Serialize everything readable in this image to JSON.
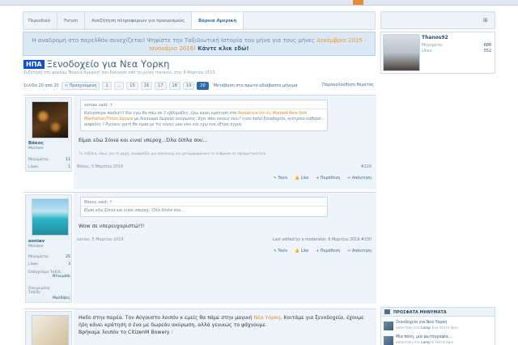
{
  "nav": {
    "breadcrumb": [
      "Περιοδικό",
      "Forum",
      "Αναζήτηση πληροφοριών για προορισμούς",
      "Βόρεια Αμερική"
    ]
  },
  "notice": {
    "line1": "Η αναδρομή στο παρελθόν συνεχίζεται! Ψηφίστε την Ταξιδιωτική Ιστορία του μήνα για τους μήνες",
    "highlight": "Δεκέμβριο 2015 - Ιανουάριο 2016!",
    "cta": "Κάντε κλικ εδώ!"
  },
  "thread": {
    "prefix": "ΗΠΑ",
    "title": "Ξενοδοχείο για Νεα Υορκη",
    "subtitle": "Συζήτηση στο φόρουμ 'Βόρεια Αμερική' που ξεκίνησε από το μέλος meraviu, στις 8 Μαρτίου 2010."
  },
  "pager": {
    "label": "Σελίδα 20 από 20",
    "prev": "< Προηγούμενη",
    "pages": [
      "1",
      "...",
      "15",
      "16",
      "17",
      "18",
      "19",
      "20"
    ],
    "active": "20",
    "jump": "Μετάβαση στο πρώτο αδιάβαστο μήνυμα",
    "watch": "Παρακολούθηση θέματος"
  },
  "posts": [
    {
      "user": "Βάκος",
      "role": "Member",
      "stats": [
        {
          "label": "Μηνύματα:",
          "value": "11"
        },
        {
          "label": "Likes:",
          "value": "1"
        }
      ],
      "quote_author": "soniav said: ↑",
      "quote_pre": "Καλησπέρα παιδιά!!! Και εγώ θα πάω σε 3 εβδομάδες ,έχω κανει κράτηση στο ",
      "quote_link": "Residence Inn by Marriott New York Manhattan/Times Square",
      "quote_post": " με δικαιωμα δωρεαν ακύρωσης. Εχει πάει κανεις εκει? ειναι καλό ξενοδοχείο, κεντρικο καθαρό , ασφαλές ? Ρωτουν γιατί θα ειμαι με τις κόρες μου εκει και έχω ένα έξτρα άγχος.",
      "text": "Είμαι εδώ Σόνια και ειναί υπεροχ...Όλα δίπλα σου...",
      "signature": "Τα ταξίδια, όπως για τη ψυχή, ακαφαλίζει μια απολαυσμ και μεταμορφώνουν το άνθρωπο σε πραγματικότητα.",
      "date": "Βάκος, 5 Μαρτίου 2019",
      "edited": "",
      "number": "#229"
    },
    {
      "user": "soniav",
      "role": "Member",
      "stats": [
        {
          "label": "Μηνύματα:",
          "value": "25"
        },
        {
          "label": "Likes:",
          "value": "3"
        },
        {
          "label": "Επάγγελμα Ταξιδ.:",
          "value": "Ντουμπάι"
        },
        {
          "label": "Ονειρεμένο Ταξίδι:",
          "value": "Μαλδίβες"
        }
      ],
      "quote_author": "Βάκος said: ↑",
      "quote_pre": "Είμαι εδώ Σόνια και ειναί υπεροχ...Όλα δίπλα σου...",
      "quote_link": "",
      "quote_post": "",
      "text": "Wow σε υπερευχαριστώ!!!",
      "signature": "",
      "date": "soniav, 5 Μαρτίου 2019",
      "edited": "Last edited by a moderator: 6 Μαρτίου 2019",
      "number": "#230"
    },
    {
      "line1_pre": "Hello στην παρέα. Τον Αύγουστο λοιπόν κ εμείς θα πάμε στην μαγική ",
      "line1_link": "Νέα Υόρκη",
      "line1_post": ". Κοιτάμε για ξενοδοχεία, έχουμε",
      "line2": "ήδη κάνει κράτηση σ ένα με δωρεάν ακύρωση, αλλά γενικώς το ψάχνουμε.",
      "line3": "Βρήκαμε λοιπόν το CitizenM Bowery :"
    }
  ],
  "actions": {
    "tools": "✎ Tools",
    "like": "👍 Like",
    "quote": "+ Παράθεση",
    "reply": "↩ Απάντηση"
  },
  "sidebar": {
    "user": "Thanos92",
    "stats": [
      {
        "label": "Μηνύματα:",
        "value": "686"
      },
      {
        "label": "Likes:",
        "value": "552"
      }
    ],
    "recent_title": "ΠΡΟΣΦΑΤΑ ΜΗΝΥΜΑΤΑ",
    "recent": [
      {
        "title": "Ξενοδοχείο για Νεα Υορκη",
        "pre": "απάντηση στο ",
        "user": "Lamp",
        "post": " Ένα λεπτό πριν"
      },
      {
        "title": "Μία πόλη, μία φωτογραφία...",
        "pre": "απάντηση στο ",
        "user": "Lamp",
        "post": " 6 λεπτά πριν"
      }
    ]
  },
  "colors": {
    "prefix_bg": "#0f4fd3",
    "accent": "#e08a2c",
    "link": "#2f6fab"
  }
}
